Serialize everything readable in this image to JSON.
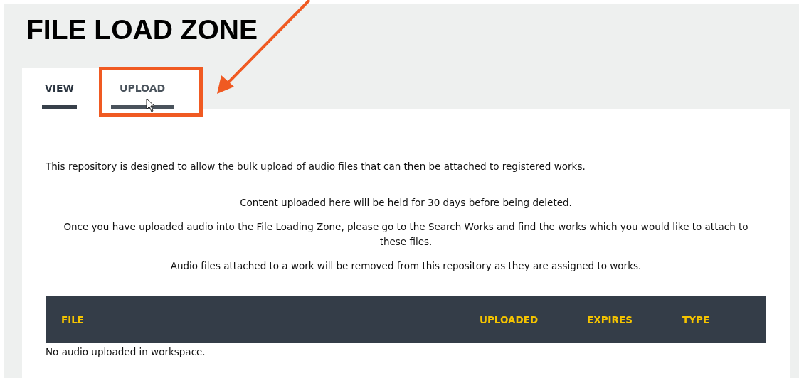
{
  "page_title": "FILE LOAD ZONE",
  "tabs": [
    {
      "label": "VIEW",
      "selected": true
    },
    {
      "label": "UPLOAD",
      "selected": false,
      "highlighted": true
    }
  ],
  "intro": "This repository is designed to allow the bulk upload of audio files that can then be attached to registered works.",
  "notice": [
    "Content uploaded here will be held for 30 days before being deleted.",
    "Once you have uploaded audio into the File Loading Zone, please go to the Search Works and find the works which you would like to attach to these files.",
    "Audio files attached to a work will be removed from this repository as they are assigned to works."
  ],
  "table": {
    "columns": [
      "FILE",
      "UPLOADED",
      "EXPIRES",
      "TYPE"
    ],
    "empty_message": "No audio uploaded in workspace."
  }
}
